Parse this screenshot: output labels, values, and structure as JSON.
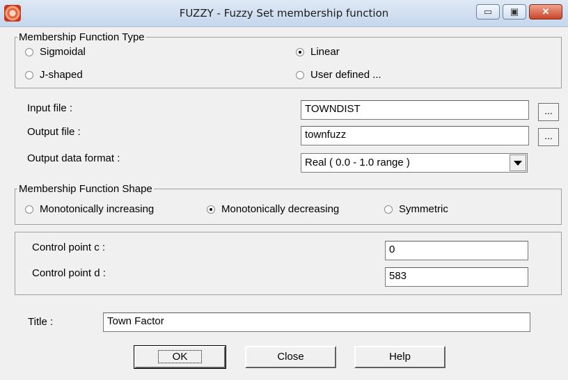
{
  "window": {
    "title": "FUZZY - Fuzzy Set membership function"
  },
  "titlebar_buttons": {
    "minimize": "▭",
    "maximize": "▣",
    "close": "✕"
  },
  "membership_type": {
    "legend": "Membership Function Type",
    "options": [
      "Sigmoidal",
      "Linear",
      "J-shaped",
      "User defined ..."
    ],
    "selected": "Linear"
  },
  "files": {
    "input_label": "Input file :",
    "input_value": "TOWNDIST",
    "output_label": "Output file :",
    "output_value": "townfuzz",
    "browse_label": "...",
    "format_label": "Output data format :",
    "format_value": "Real  ( 0.0 - 1.0 range )"
  },
  "shape": {
    "legend": "Membership Function Shape",
    "options": [
      "Monotonically increasing",
      "Monotonically decreasing",
      "Symmetric"
    ],
    "selected": "Monotonically decreasing"
  },
  "control_points": {
    "c_label": "Control point c :",
    "c_value": "0",
    "d_label": "Control point d :",
    "d_value": "583"
  },
  "title_field": {
    "label": "Title :",
    "value": "Town Factor"
  },
  "buttons": {
    "ok": "OK",
    "close": "Close",
    "help": "Help"
  }
}
